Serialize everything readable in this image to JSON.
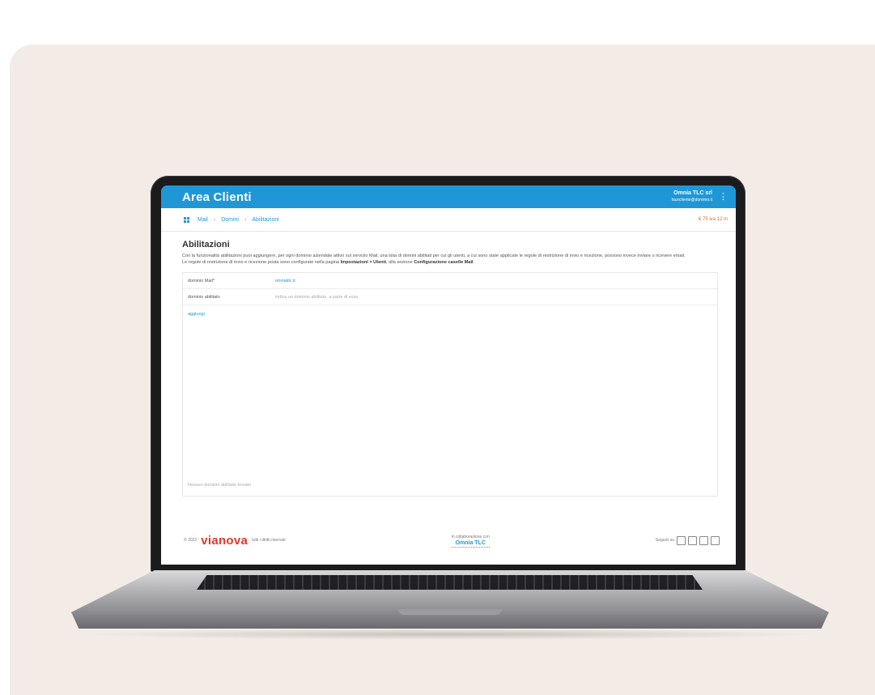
{
  "header": {
    "app_title": "Area Clienti",
    "account_name": "Omnia TLC srl",
    "account_email": "fauxcliente@dominio.it"
  },
  "nav": {
    "breadcrumb": [
      "Mail",
      "Domini",
      "Abilitazioni"
    ],
    "credits": "€ 75 iva 12 m"
  },
  "page": {
    "title": "Abilitazioni",
    "description_1": "Con la funzionalità abilitazioni puoi aggiungere, per ogni dominio aziendale attivo sul servizio Mail, una lista di domini abilitati per cui gli utenti, a cui sono state applicate le regole di restrizione di invio e ricezione, possono invece inviare o ricevere email.",
    "description_2_prefix": "Le regole di restrizione di invio e ricezione posta sono configurate nella pagina",
    "description_link_1": "Impostazioni > Utenti",
    "description_2_middle": ", alla sezione",
    "description_link_2": "Configurazione caselle Mail"
  },
  "form": {
    "rows": [
      {
        "label": "dominio Mail*",
        "value": "omniatlc.it"
      },
      {
        "label": "dominio abilitato",
        "placeholder": "indica un dominio abilitato, a parte di esso"
      }
    ],
    "add_link": "aggiungi",
    "empty_message": "Nessun dominio abilitato trovato"
  },
  "footer": {
    "copyright": "© 2022",
    "brand": "vianova",
    "rights": "tutti i diritti riservati",
    "collab_label": "in collaborazione con",
    "partner": "Omnia TLC",
    "follow": "Seguici su"
  },
  "colors": {
    "accent": "#1f97d7",
    "brand_red": "#e2382c",
    "credit_orange": "#e16c2c",
    "backdrop": "#f3ece6"
  },
  "icons": [
    "grid-icon",
    "kebab-menu-icon",
    "linkedin-icon",
    "facebook-icon",
    "twitter-icon",
    "youtube-icon"
  ]
}
